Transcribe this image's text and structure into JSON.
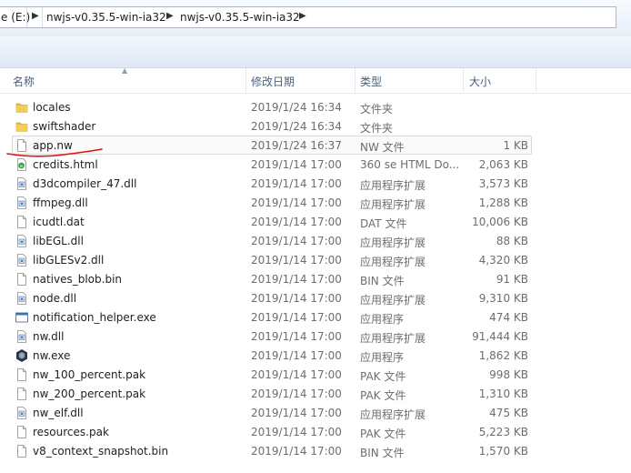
{
  "address": {
    "drive": "e (E:)",
    "crumbs": [
      "nwjs-v0.35.5-win-ia32",
      "nwjs-v0.35.5-win-ia32"
    ]
  },
  "columns": {
    "name": "名称",
    "date": "修改日期",
    "type": "类型",
    "size": "大小"
  },
  "files": [
    {
      "name": "locales",
      "date": "2019/1/24 16:34",
      "type": "文件夹",
      "size": "",
      "icon": "folder-icon"
    },
    {
      "name": "swiftshader",
      "date": "2019/1/24 16:34",
      "type": "文件夹",
      "size": "",
      "icon": "folder-icon"
    },
    {
      "name": "app.nw",
      "date": "2019/1/24 16:37",
      "type": "NW 文件",
      "size": "1 KB",
      "icon": "file-icon"
    },
    {
      "name": "credits.html",
      "date": "2019/1/14 17:00",
      "type": "360 se HTML Do...",
      "size": "2,063 KB",
      "icon": "html-file-icon"
    },
    {
      "name": "d3dcompiler_47.dll",
      "date": "2019/1/14 17:00",
      "type": "应用程序扩展",
      "size": "3,573 KB",
      "icon": "dll-file-icon"
    },
    {
      "name": "ffmpeg.dll",
      "date": "2019/1/14 17:00",
      "type": "应用程序扩展",
      "size": "1,288 KB",
      "icon": "dll-file-icon"
    },
    {
      "name": "icudtl.dat",
      "date": "2019/1/14 17:00",
      "type": "DAT 文件",
      "size": "10,006 KB",
      "icon": "file-icon"
    },
    {
      "name": "libEGL.dll",
      "date": "2019/1/14 17:00",
      "type": "应用程序扩展",
      "size": "88 KB",
      "icon": "dll-file-icon"
    },
    {
      "name": "libGLESv2.dll",
      "date": "2019/1/14 17:00",
      "type": "应用程序扩展",
      "size": "4,320 KB",
      "icon": "dll-file-icon"
    },
    {
      "name": "natives_blob.bin",
      "date": "2019/1/14 17:00",
      "type": "BIN 文件",
      "size": "91 KB",
      "icon": "file-icon"
    },
    {
      "name": "node.dll",
      "date": "2019/1/14 17:00",
      "type": "应用程序扩展",
      "size": "9,310 KB",
      "icon": "dll-file-icon"
    },
    {
      "name": "notification_helper.exe",
      "date": "2019/1/14 17:00",
      "type": "应用程序",
      "size": "474 KB",
      "icon": "exe-file-icon"
    },
    {
      "name": "nw.dll",
      "date": "2019/1/14 17:00",
      "type": "应用程序扩展",
      "size": "91,444 KB",
      "icon": "dll-file-icon"
    },
    {
      "name": "nw.exe",
      "date": "2019/1/14 17:00",
      "type": "应用程序",
      "size": "1,862 KB",
      "icon": "nw-app-icon"
    },
    {
      "name": "nw_100_percent.pak",
      "date": "2019/1/14 17:00",
      "type": "PAK 文件",
      "size": "998 KB",
      "icon": "file-icon"
    },
    {
      "name": "nw_200_percent.pak",
      "date": "2019/1/14 17:00",
      "type": "PAK 文件",
      "size": "1,310 KB",
      "icon": "file-icon"
    },
    {
      "name": "nw_elf.dll",
      "date": "2019/1/14 17:00",
      "type": "应用程序扩展",
      "size": "475 KB",
      "icon": "dll-file-icon"
    },
    {
      "name": "resources.pak",
      "date": "2019/1/14 17:00",
      "type": "PAK 文件",
      "size": "5,223 KB",
      "icon": "file-icon"
    },
    {
      "name": "v8_context_snapshot.bin",
      "date": "2019/1/14 17:00",
      "type": "BIN 文件",
      "size": "1,570 KB",
      "icon": "file-icon"
    }
  ],
  "highlighted_file": "app.nw",
  "colors": {
    "folder": "#e8b93a",
    "annotation": "#e01010",
    "selection_border": "#d9d9d9"
  }
}
